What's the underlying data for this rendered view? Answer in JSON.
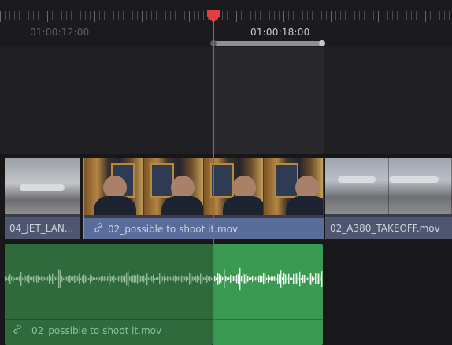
{
  "ruler": {
    "timecode_left": "01:00:12:00",
    "timecode_right": "01:00:18:00"
  },
  "video_clips": [
    {
      "name": "04_JET_LAN...",
      "link_icon": ""
    },
    {
      "name": "02_possible to shoot it.mov",
      "link_icon": "link-icon"
    },
    {
      "name": "02_A380_TAKEOFF.mov",
      "link_icon": ""
    }
  ],
  "audio_clip": {
    "name": "02_possible to shoot it.mov",
    "link_icon": "link-icon"
  },
  "colors": {
    "playhead": "#e24040",
    "video_clip_selected": "#5a6d9a",
    "audio_clip": "#2f6a3c",
    "audio_clip_selected": "#3b9a52"
  }
}
